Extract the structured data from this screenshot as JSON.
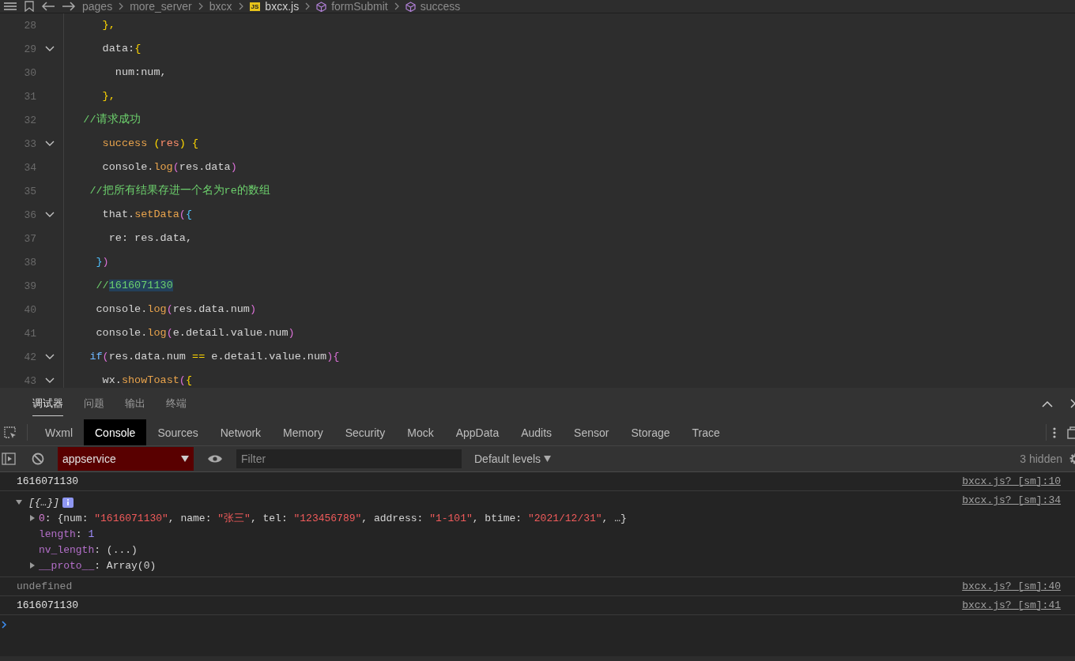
{
  "breadcrumb": {
    "items": [
      {
        "text": "pages",
        "kind": "folder"
      },
      {
        "text": "more_server",
        "kind": "folder"
      },
      {
        "text": "bxcx",
        "kind": "folder"
      },
      {
        "text": "bxcx.js",
        "kind": "file",
        "badge": "JS"
      },
      {
        "text": "formSubmit",
        "kind": "method"
      },
      {
        "text": "success",
        "kind": "method"
      }
    ]
  },
  "editor": {
    "lines": [
      {
        "number": "28",
        "fold": false,
        "tokens": [
          {
            "text": "      },",
            "kind": "brace"
          }
        ]
      },
      {
        "number": "29",
        "fold": true,
        "tokens": [
          {
            "text": "      data:",
            "kind": "plain"
          },
          {
            "text": "{",
            "kind": "brace"
          }
        ]
      },
      {
        "number": "30",
        "fold": false,
        "tokens": [
          {
            "text": "        num:num,",
            "kind": "plain"
          }
        ]
      },
      {
        "number": "31",
        "fold": false,
        "tokens": [
          {
            "text": "      },",
            "kind": "brace"
          }
        ]
      },
      {
        "number": "32",
        "fold": false,
        "tokens": [
          {
            "text": "   //请求成功",
            "kind": "comment"
          }
        ]
      },
      {
        "number": "33",
        "fold": true,
        "tokens": [
          {
            "text": "      success ",
            "kind": "func"
          },
          {
            "text": "(",
            "kind": "brace"
          },
          {
            "text": "res",
            "kind": "param"
          },
          {
            "text": ") {",
            "kind": "brace"
          }
        ]
      },
      {
        "number": "34",
        "fold": false,
        "tokens": [
          {
            "text": "      console.",
            "kind": "plain"
          },
          {
            "text": "log",
            "kind": "func"
          },
          {
            "text": "(",
            "kind": "paren"
          },
          {
            "text": "res.data",
            "kind": "plain"
          },
          {
            "text": ")",
            "kind": "paren"
          }
        ]
      },
      {
        "number": "35",
        "fold": false,
        "tokens": [
          {
            "text": "    //把所有结果存进一个名为re的数组",
            "kind": "comment"
          }
        ]
      },
      {
        "number": "36",
        "fold": true,
        "tokens": [
          {
            "text": "      that.",
            "kind": "plain"
          },
          {
            "text": "setData",
            "kind": "func"
          },
          {
            "text": "(",
            "kind": "paren"
          },
          {
            "text": "{",
            "kind": "bracket"
          }
        ]
      },
      {
        "number": "37",
        "fold": false,
        "tokens": [
          {
            "text": "       re: res.data,",
            "kind": "plain"
          }
        ]
      },
      {
        "number": "38",
        "fold": false,
        "tokens": [
          {
            "text": "     }",
            "kind": "bracket"
          },
          {
            "text": ")",
            "kind": "paren"
          }
        ]
      },
      {
        "number": "39",
        "fold": false,
        "tokens": [
          {
            "text": "     //",
            "kind": "comment"
          },
          {
            "text": "1616071130",
            "kind": "match"
          }
        ]
      },
      {
        "number": "40",
        "fold": false,
        "tokens": [
          {
            "text": "     console.",
            "kind": "plain"
          },
          {
            "text": "log",
            "kind": "func"
          },
          {
            "text": "(",
            "kind": "paren"
          },
          {
            "text": "res.data.num",
            "kind": "plain"
          },
          {
            "text": ")",
            "kind": "paren"
          }
        ]
      },
      {
        "number": "41",
        "fold": false,
        "tokens": [
          {
            "text": "     console.",
            "kind": "plain"
          },
          {
            "text": "log",
            "kind": "func"
          },
          {
            "text": "(",
            "kind": "paren"
          },
          {
            "text": "e.detail.value.num",
            "kind": "plain"
          },
          {
            "text": ")",
            "kind": "paren"
          }
        ]
      },
      {
        "number": "42",
        "fold": true,
        "tokens": [
          {
            "text": "    if",
            "kind": "keyword"
          },
          {
            "text": "(",
            "kind": "paren"
          },
          {
            "text": "res.data.num ",
            "kind": "plain"
          },
          {
            "text": "==",
            "kind": "brace"
          },
          {
            "text": " e.detail.value.num",
            "kind": "plain"
          },
          {
            "text": ")",
            "kind": "paren"
          },
          {
            "text": "{",
            "kind": "paren"
          }
        ]
      },
      {
        "number": "43",
        "fold": true,
        "tokens": [
          {
            "text": "      wx.",
            "kind": "plain"
          },
          {
            "text": "showToast",
            "kind": "func"
          },
          {
            "text": "(",
            "kind": "paren"
          },
          {
            "text": "{",
            "kind": "brace"
          }
        ]
      }
    ]
  },
  "panel_tabs": [
    {
      "label": "调试器",
      "selected": true
    },
    {
      "label": "问题",
      "selected": false
    },
    {
      "label": "输出",
      "selected": false
    },
    {
      "label": "终端",
      "selected": false
    }
  ],
  "devtools_tabs": [
    {
      "label": "Wxml",
      "selected": false
    },
    {
      "label": "Console",
      "selected": true
    },
    {
      "label": "Sources",
      "selected": false
    },
    {
      "label": "Network",
      "selected": false
    },
    {
      "label": "Memory",
      "selected": false
    },
    {
      "label": "Security",
      "selected": false
    },
    {
      "label": "Mock",
      "selected": false
    },
    {
      "label": "AppData",
      "selected": false
    },
    {
      "label": "Audits",
      "selected": false
    },
    {
      "label": "Sensor",
      "selected": false
    },
    {
      "label": "Storage",
      "selected": false
    },
    {
      "label": "Trace",
      "selected": false
    }
  ],
  "toolbar": {
    "context": "appservice",
    "filter_placeholder": "Filter",
    "levels": "Default levels",
    "hidden_count": "3 hidden"
  },
  "console": {
    "messages": [
      {
        "kind": "text",
        "text": "1616071130",
        "source": "bxcx.js? [sm]:10"
      },
      {
        "kind": "object",
        "summary": "[{…}]",
        "source": "bxcx.js? [sm]:34",
        "expanded": true,
        "children": [
          {
            "key": "0",
            "kind": "index",
            "expandable": true,
            "value": [
              {
                "text": ": ",
                "kind": "plain"
              },
              {
                "text": "{num: ",
                "kind": "plain"
              },
              {
                "text": "\"1616071130\"",
                "kind": "string"
              },
              {
                "text": ", name: ",
                "kind": "plain"
              },
              {
                "text": "\"张三\"",
                "kind": "string"
              },
              {
                "text": ", tel: ",
                "kind": "plain"
              },
              {
                "text": "\"123456789\"",
                "kind": "string"
              },
              {
                "text": ", address: ",
                "kind": "plain"
              },
              {
                "text": "\"1-101\"",
                "kind": "string"
              },
              {
                "text": ", btime: ",
                "kind": "plain"
              },
              {
                "text": "\"2021/12/31\"",
                "kind": "string"
              },
              {
                "text": ", …}",
                "kind": "plain"
              }
            ]
          },
          {
            "key": "length",
            "kind": "own",
            "expandable": false,
            "value": [
              {
                "text": ": ",
                "kind": "plain"
              },
              {
                "text": "1",
                "kind": "number"
              }
            ]
          },
          {
            "key": "nv_length",
            "kind": "own",
            "expandable": false,
            "value": [
              {
                "text": ": ",
                "kind": "plain"
              },
              {
                "text": "(...)",
                "kind": "plain"
              }
            ]
          },
          {
            "key": "__proto__",
            "kind": "own",
            "expandable": true,
            "value": [
              {
                "text": ": ",
                "kind": "plain"
              },
              {
                "text": "Array(0)",
                "kind": "plain"
              }
            ]
          }
        ]
      },
      {
        "kind": "undefined",
        "text": "undefined",
        "source": "bxcx.js? [sm]:40"
      },
      {
        "kind": "text",
        "text": "1616071130",
        "source": "bxcx.js? [sm]:41"
      }
    ]
  }
}
